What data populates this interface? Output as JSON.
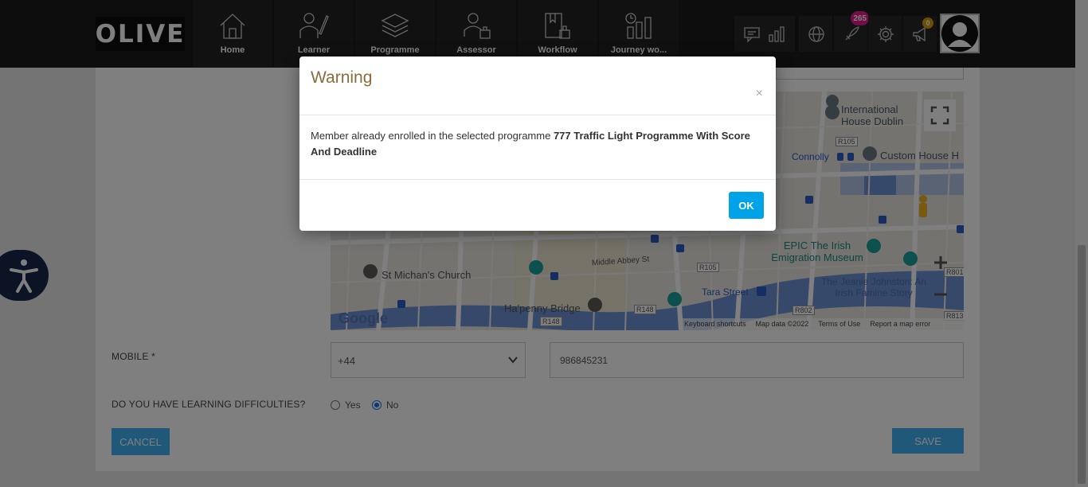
{
  "app": {
    "logo": "OLIVE"
  },
  "nav": [
    {
      "label": "Home",
      "icon": "home-icon"
    },
    {
      "label": "Learner",
      "icon": "learner-icon"
    },
    {
      "label": "Programme",
      "icon": "programme-icon"
    },
    {
      "label": "Assessor",
      "icon": "assessor-icon"
    },
    {
      "label": "Workflow",
      "icon": "workflow-icon"
    },
    {
      "label": "Journey wo...",
      "icon": "journey-icon"
    }
  ],
  "tools": {
    "notifications_badge": "265",
    "announcements_badge": "0",
    "notification_badge_color": "#e21c8e",
    "announcement_badge_color": "#d4a10a"
  },
  "map": {
    "labels": {
      "international_house": "International House Dublin",
      "custom_house": "Custom House H",
      "connolly": "Connolly",
      "epic": "EPIC The Irish Emigration Museum",
      "jeanie": "The Jeanie Johnston: An Irish Famine Story",
      "st_michans": "St Michan's Church",
      "hapenny": "Ha'penny Bridge",
      "tara": "Tara Street",
      "middle_abbey": "Middle Abbey St",
      "r105a": "R105",
      "r105b": "R105",
      "r148a": "R148",
      "r148b": "R148",
      "r802": "R802",
      "r801": "R801",
      "r813": "R813",
      "google": "Google",
      "keyboard": "Keyboard shortcuts",
      "mapdata": "Map data ©2022",
      "terms": "Terms of Use",
      "report": "Report a map error"
    }
  },
  "form": {
    "mobile_label": "MOBILE *",
    "country_code": "+44",
    "mobile_number": "986845231",
    "difficulties_label": "DO YOU HAVE LEARNING DIFFICULTIES?",
    "yes_label": "Yes",
    "no_label": "No",
    "selected": "No",
    "cancel_label": "CANCEL",
    "save_label": "SAVE"
  },
  "modal": {
    "title": "Warning",
    "close": "×",
    "message_prefix": "Member already enrolled in the selected programme ",
    "programme_name": "777 Traffic Light Programme With Score And Deadline",
    "ok_label": "OK"
  }
}
